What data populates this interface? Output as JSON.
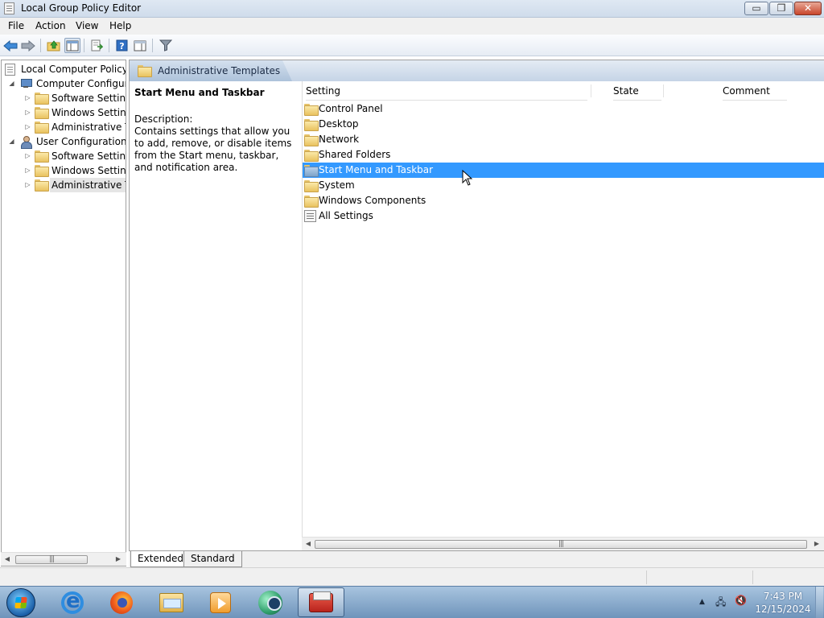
{
  "window": {
    "title": "Local Group Policy Editor",
    "controls": {
      "minimize": "▭",
      "maximize": "❐",
      "close": "✕"
    }
  },
  "menubar": [
    "File",
    "Action",
    "View",
    "Help"
  ],
  "toolbar": {
    "icons": [
      "back-arrow-icon",
      "forward-arrow-icon",
      "up-folder-icon",
      "show-hide-tree-icon",
      "export-list-icon",
      "help-icon",
      "properties-pane-icon",
      "filter-icon"
    ]
  },
  "tree": {
    "root": "Local Computer Policy",
    "computer": {
      "label": "Computer Configura",
      "children": [
        "Software Settings",
        "Windows Setting",
        "Administrative Te"
      ]
    },
    "user": {
      "label": "User Configuration",
      "children": [
        "Software Settings",
        "Windows Setting",
        "Administrative Te"
      ]
    }
  },
  "main": {
    "breadcrumb": "Administrative Templates",
    "desc_title": "Start Menu and Taskbar",
    "desc_label": "Description:",
    "desc_body": "Contains settings that allow you to add, remove, or disable items from the Start menu, taskbar, and notification area.",
    "columns": {
      "setting": "Setting",
      "state": "State",
      "comment": "Comment"
    },
    "rows": [
      "Control Panel",
      "Desktop",
      "Network",
      "Shared Folders",
      "Start Menu and Taskbar",
      "System",
      "Windows Components",
      "All Settings"
    ],
    "selected_row": "Start Menu and Taskbar"
  },
  "scrollbar_grip": "|||",
  "view_tabs": {
    "extended": "Extended",
    "standard": "Standard"
  },
  "taskbar": {
    "apps": [
      "internet-explorer-icon",
      "firefox-icon",
      "windows-explorer-icon",
      "media-player-icon",
      "browser-globe-icon",
      "group-policy-editor-icon"
    ],
    "clock_time": "7:43 PM",
    "clock_date": "12/15/2024",
    "tray": {
      "show_hidden": "▲",
      "network": "🖧",
      "volume": "🔇"
    }
  },
  "colors": {
    "selection": "#3399ff",
    "titlebar": "#dfe8f3",
    "taskbar": "#8fb0d2"
  }
}
